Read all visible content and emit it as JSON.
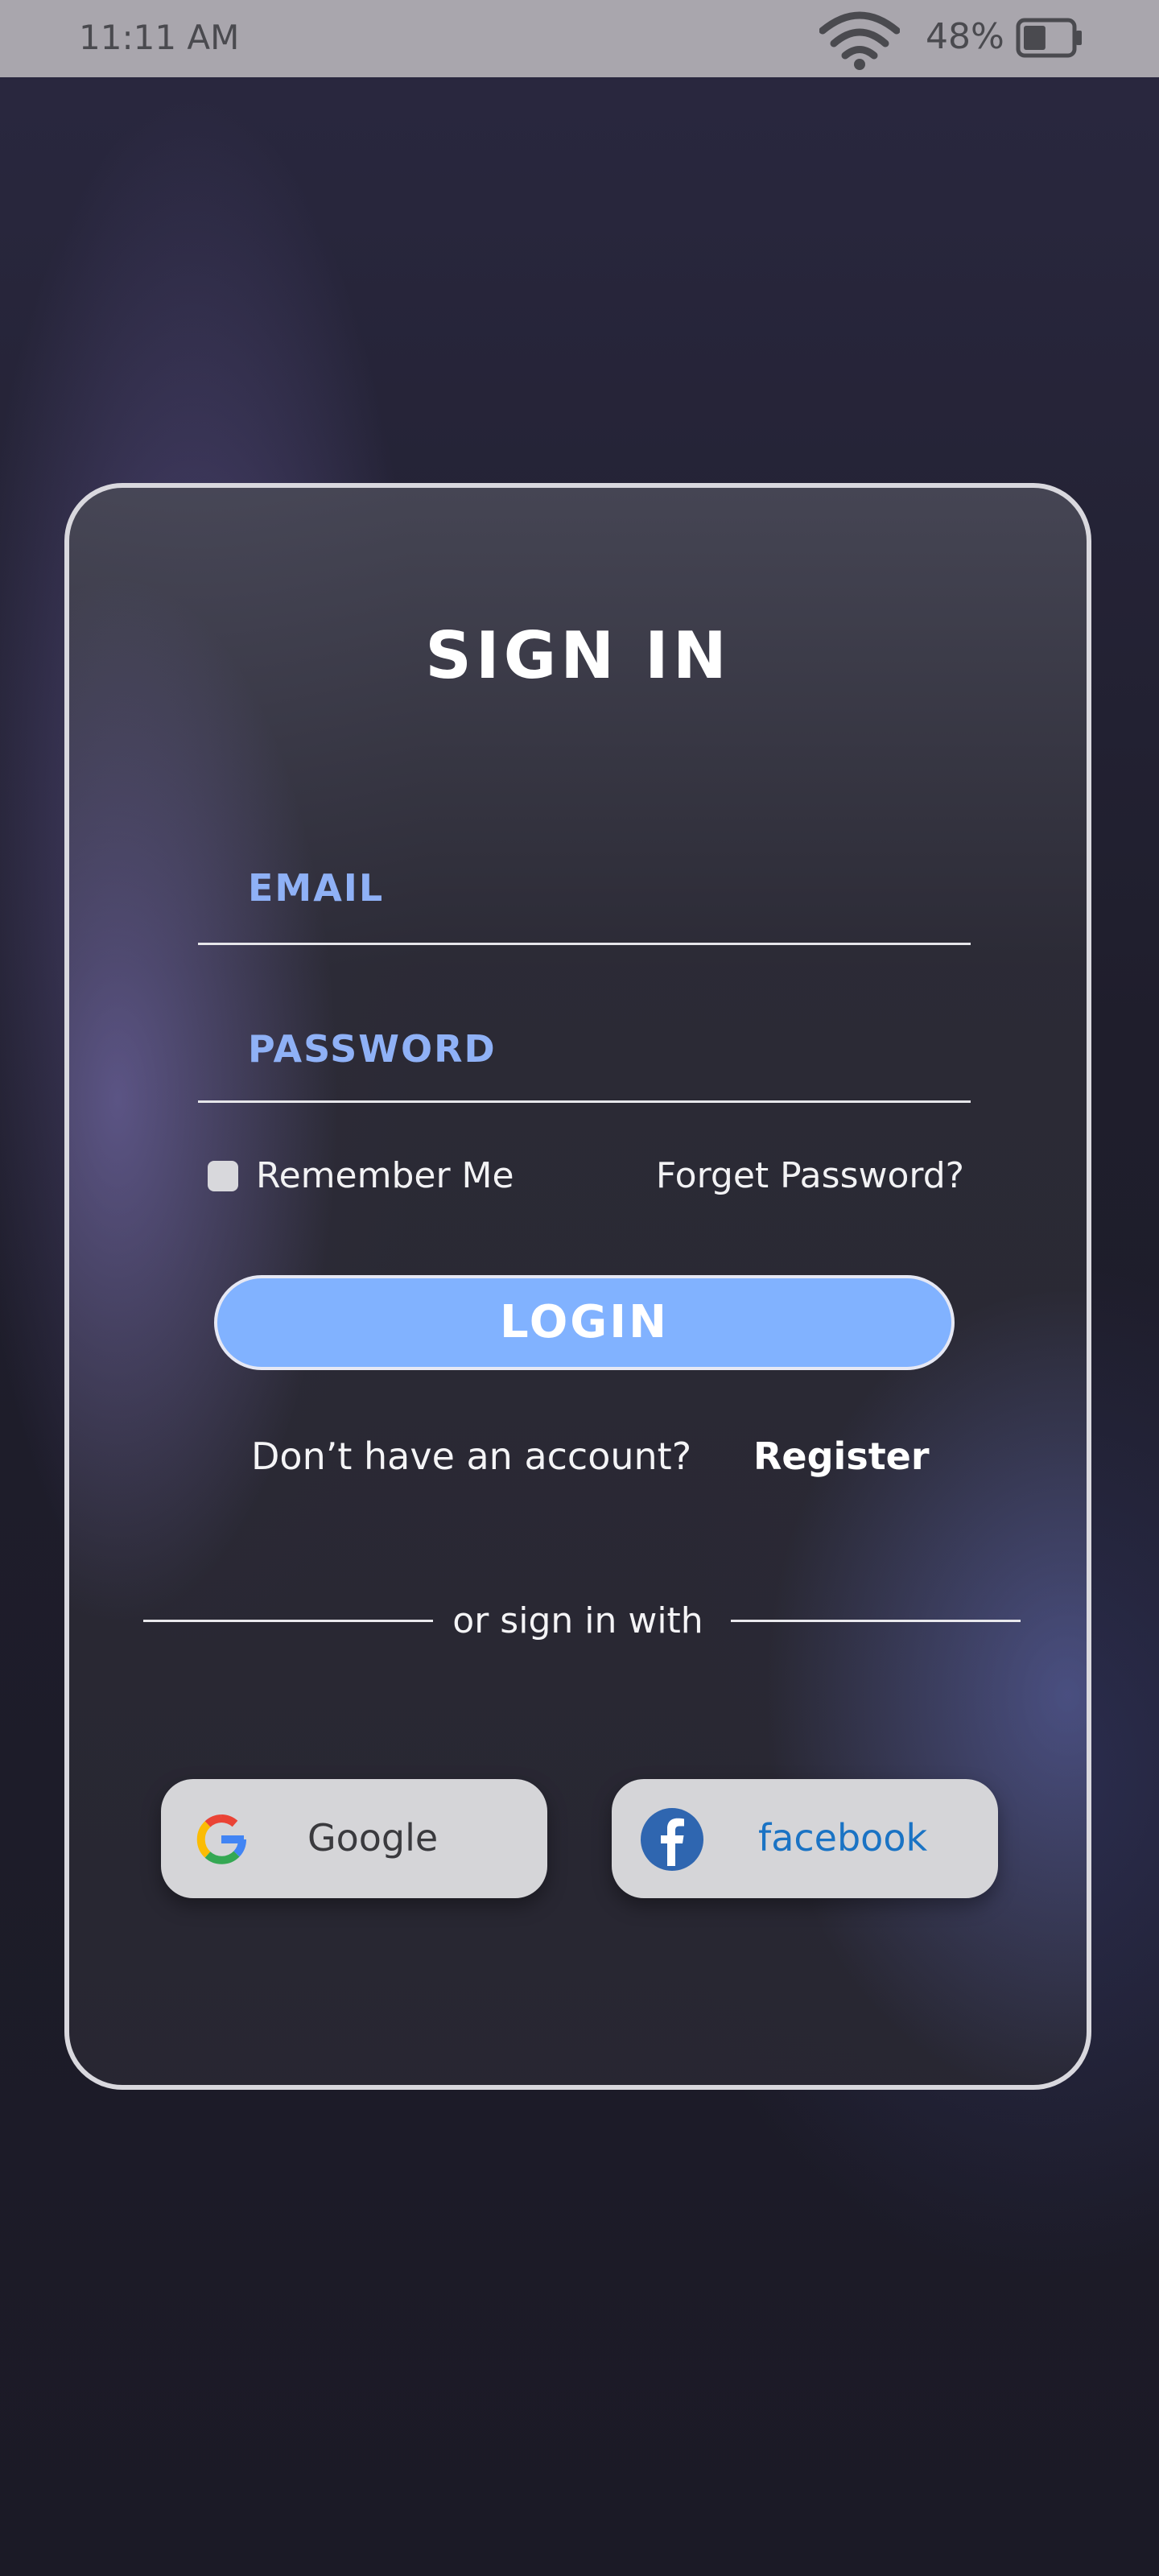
{
  "status_bar": {
    "time": "11:11 AM",
    "battery_percent": "48%",
    "battery_level": 0.48,
    "wifi_icon": "wifi-icon",
    "battery_icon": "battery-icon"
  },
  "signin": {
    "title": "SIGN IN",
    "email_label": "EMAIL",
    "email_value": "",
    "password_label": "PASSWORD",
    "password_value": "",
    "remember_label": "Remember Me",
    "remember_checked": false,
    "forgot_label": "Forget Password?",
    "login_label": "LOGIN",
    "no_account_text": "Don’t have an account?",
    "register_label": "Register",
    "divider_text": "or sign in with"
  },
  "social": {
    "google_label": "Google",
    "google_icon": "google-icon",
    "facebook_label": "facebook",
    "facebook_icon": "facebook-icon"
  },
  "colors": {
    "accent": "#81b2ff",
    "label_blue": "#8fb1f6",
    "facebook_blue": "#2f66b0",
    "facebook_text": "#1a73c4",
    "social_bg": "#d5d5d8"
  }
}
